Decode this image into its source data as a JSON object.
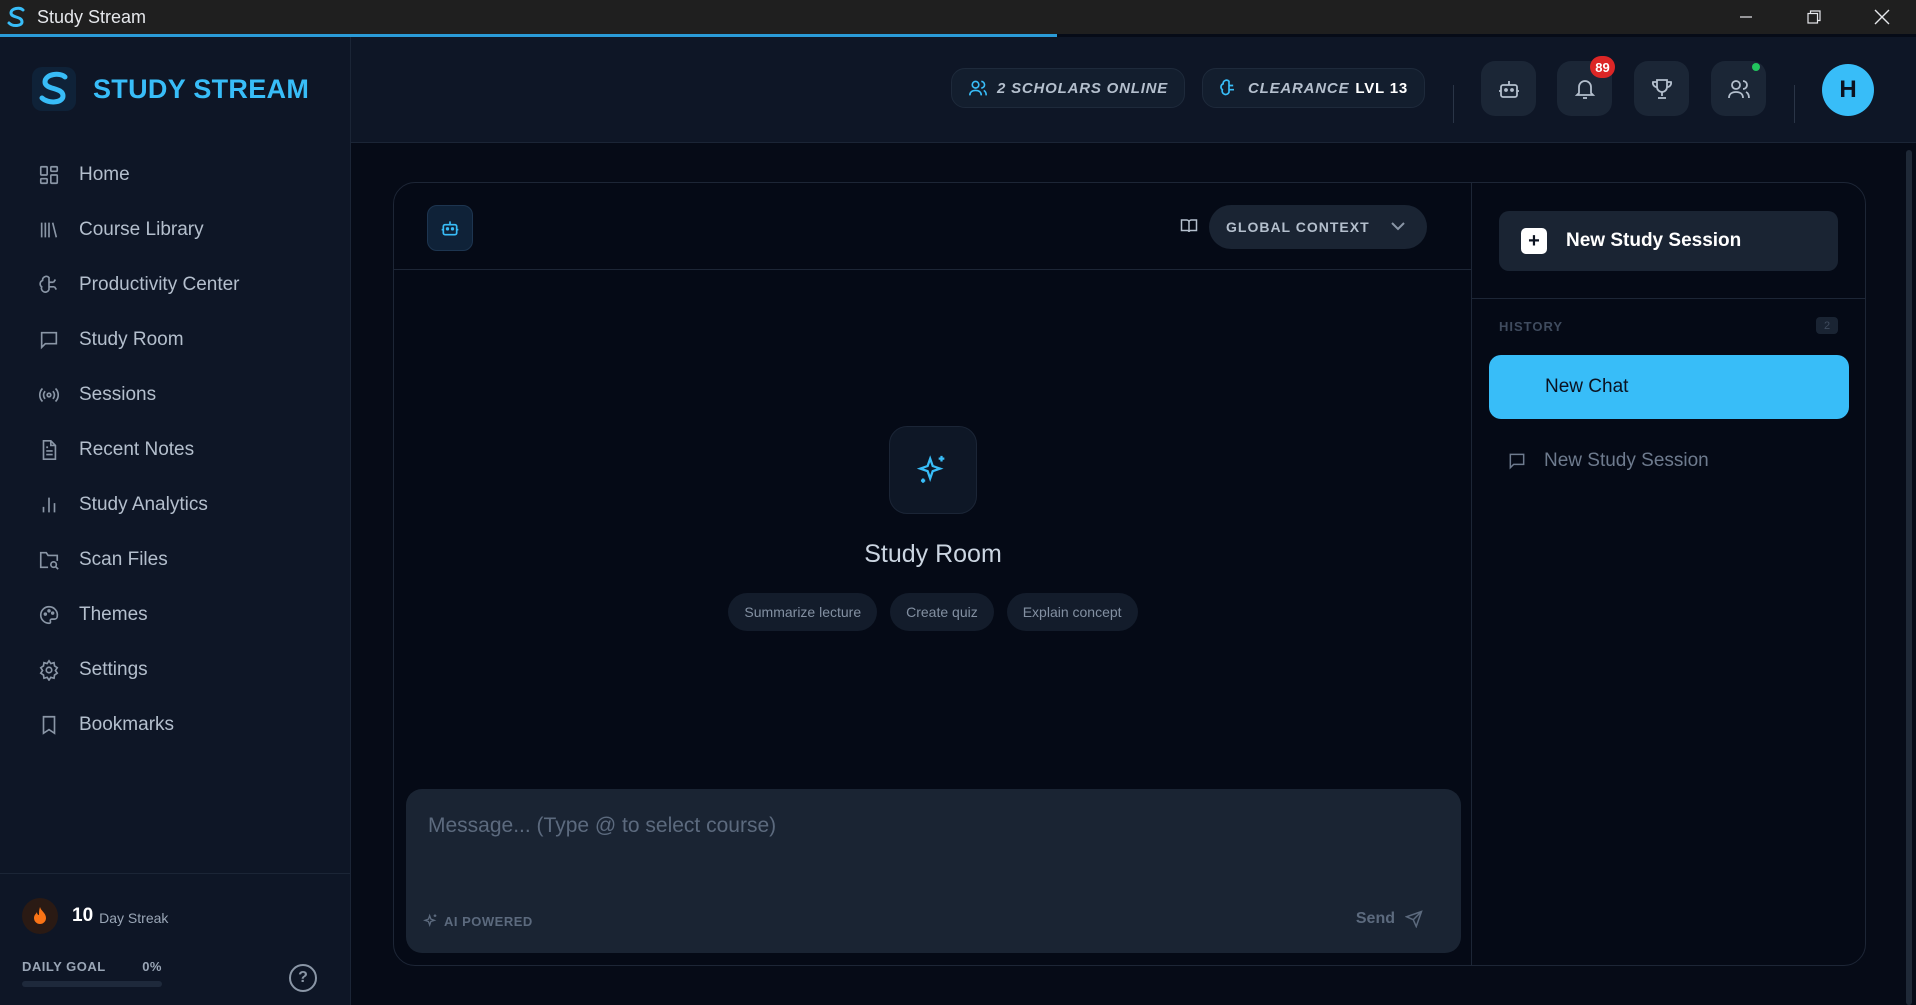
{
  "window": {
    "title": "Study Stream"
  },
  "brand": {
    "name": "STUDY STREAM"
  },
  "nav": {
    "items": [
      {
        "label": "Home",
        "icon": "home-grid-icon"
      },
      {
        "label": "Course Library",
        "icon": "library-icon"
      },
      {
        "label": "Productivity Center",
        "icon": "brain-icon"
      },
      {
        "label": "Study Room",
        "icon": "chat-bubble-icon"
      },
      {
        "label": "Sessions",
        "icon": "broadcast-icon"
      },
      {
        "label": "Recent Notes",
        "icon": "document-icon"
      },
      {
        "label": "Study Analytics",
        "icon": "bar-chart-icon"
      },
      {
        "label": "Scan Files",
        "icon": "folder-search-icon"
      },
      {
        "label": "Themes",
        "icon": "palette-icon"
      },
      {
        "label": "Settings",
        "icon": "gear-icon"
      },
      {
        "label": "Bookmarks",
        "icon": "bookmark-icon"
      }
    ]
  },
  "footer": {
    "streak_value": "10",
    "streak_label": "Day Streak",
    "goal_label": "DAILY GOAL",
    "goal_percent_text": "0%",
    "goal_fraction": 0,
    "help_symbol": "?"
  },
  "header": {
    "scholars_online": "2 SCHOLARS ONLINE",
    "clearance_label": "CLEARANCE",
    "clearance_level": "LVL 13",
    "notification_count": "89",
    "avatar_initial": "H"
  },
  "chat": {
    "context_label": "GLOBAL CONTEXT",
    "empty_title": "Study Room",
    "suggestions": [
      "Summarize lecture",
      "Create quiz",
      "Explain concept"
    ],
    "input_placeholder": "Message... (Type @ to select course)",
    "ai_powered": "AI POWERED",
    "send_label": "Send"
  },
  "history": {
    "new_session_label": "New Study Session",
    "heading": "HISTORY",
    "count": "2",
    "items": [
      {
        "label": "New Chat",
        "active": true
      },
      {
        "label": "New Study Session",
        "active": false
      }
    ]
  },
  "colors": {
    "accent": "#38bdf8",
    "background": "#060b17",
    "sidebar": "#0e1626",
    "badge": "#dc2626"
  }
}
